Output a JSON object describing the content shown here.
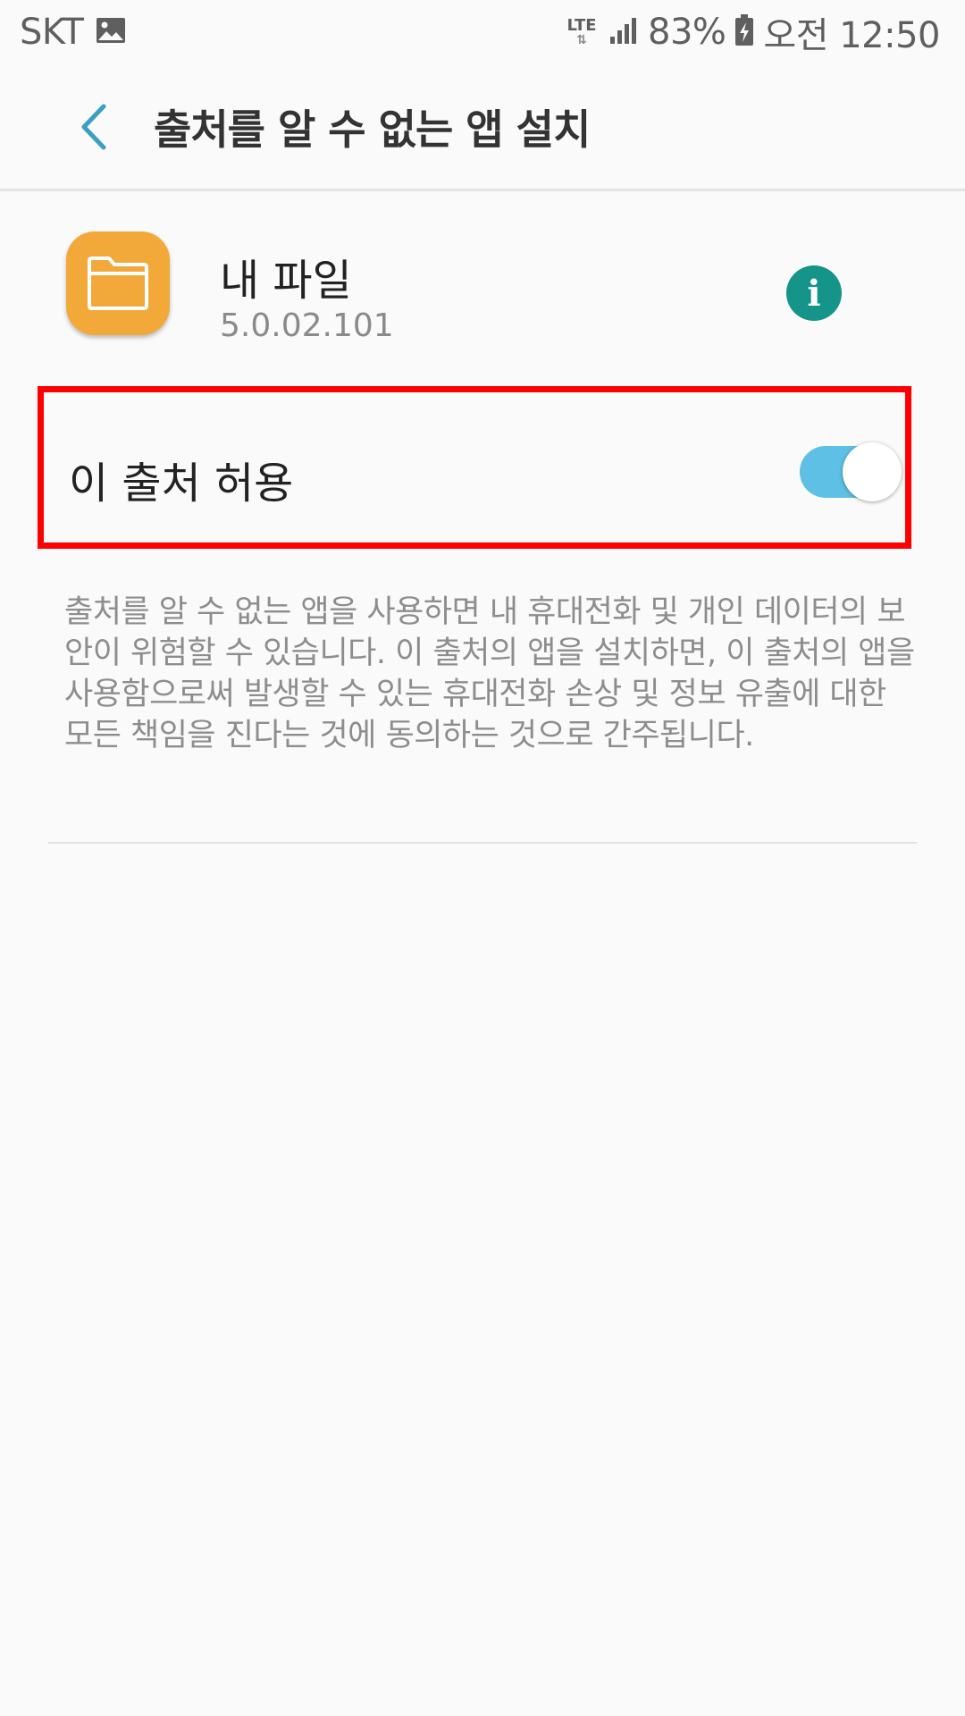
{
  "status_bar": {
    "carrier": "SKT",
    "network": "LTE",
    "battery": "83%",
    "time": "오전 12:50"
  },
  "app_bar": {
    "title": "출처를 알 수 없는 앱 설치"
  },
  "app": {
    "name": "내 파일",
    "version": "5.0.02.101",
    "icon_color": "#f3a93a"
  },
  "allow_source": {
    "label": "이 출처 허용",
    "enabled": true,
    "toggle_color": "#5ec0e4"
  },
  "warning": {
    "text": "출처를 알 수 없는 앱을 사용하면 내 휴대전화 및 개인 데이터의 보안이 위험할 수 있습니다. 이 출처의 앱을 설치하면, 이 출처의 앱을 사용함으로써 발생할 수 있는 휴대전화 손상 및 정보 유출에 대한 모든 책임을 진다는 것에 동의하는 것으로 간주됩니다."
  }
}
